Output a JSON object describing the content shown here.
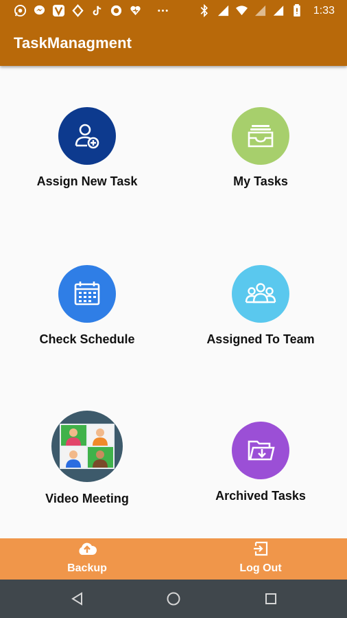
{
  "status_bar": {
    "time": "1:33",
    "left_icons": [
      "whatsapp-icon",
      "messenger-icon",
      "viber-icon",
      "sync-icon",
      "tiktok-icon",
      "record-icon",
      "heart-shield-icon",
      "more-dots-icon"
    ],
    "right_icons": [
      "bluetooth-icon",
      "lte-icon",
      "wifi-icon",
      "lte-signal-icon",
      "signal-icon",
      "battery-icon"
    ]
  },
  "app_bar": {
    "title": "TaskManagment"
  },
  "tiles": [
    {
      "label": "Assign New Task",
      "icon": "add-user-icon",
      "color": "#0d3a8e"
    },
    {
      "label": "My Tasks",
      "icon": "inbox-tray-icon",
      "color": "#a7cf6c"
    },
    {
      "label": "Check Schedule",
      "icon": "calendar-icon",
      "color": "#2f7ee6"
    },
    {
      "label": "Assigned To Team",
      "icon": "team-icon",
      "color": "#5ac8ee"
    },
    {
      "label": "Video Meeting",
      "icon": "video-meeting-icon",
      "color": "#3d5a6b"
    },
    {
      "label": "Archived Tasks",
      "icon": "folder-download-icon",
      "color": "#9b4fd6"
    }
  ],
  "bottom_bar": {
    "backup_label": "Backup",
    "logout_label": "Log Out"
  },
  "colors": {
    "app_bar": "#b8690a",
    "bottom_bar": "#f0964a",
    "nav_bar": "#40474c"
  }
}
